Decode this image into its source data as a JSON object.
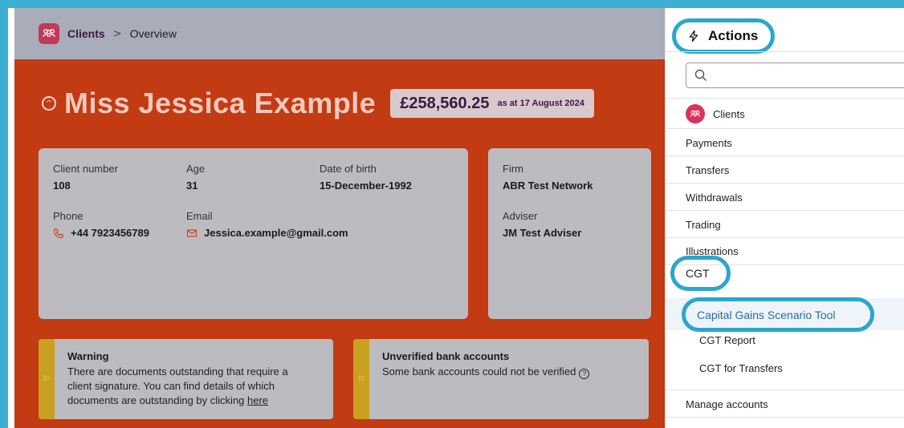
{
  "breadcrumb": {
    "section": "Clients",
    "separator": ">",
    "page": "Overview"
  },
  "client": {
    "name": "Miss Jessica Example",
    "value": "£258,560.25",
    "value_date": "as at 17 August 2024",
    "details": {
      "client_number_label": "Client number",
      "client_number": "108",
      "age_label": "Age",
      "age": "31",
      "dob_label": "Date of birth",
      "dob": "15-December-1992",
      "phone_label": "Phone",
      "phone": "+44 7923456789",
      "email_label": "Email",
      "email": "Jessica.example@gmail.com"
    },
    "firm": {
      "firm_label": "Firm",
      "firm": "ABR Test Network",
      "adviser_label": "Adviser",
      "adviser": "JM Test Adviser"
    }
  },
  "alerts": {
    "warning": {
      "title": "Warning",
      "line1": "There are documents outstanding that require a",
      "line2": "client signature. You can find details of which",
      "line3": "documents are outstanding by clicking ",
      "link": "here"
    },
    "bank": {
      "title": "Unverified bank accounts",
      "body": "Some bank accounts could not be verified",
      "help": "?"
    }
  },
  "actions": {
    "title": "Actions",
    "search_placeholder": "",
    "clients_label": "Clients",
    "items": {
      "payments": "Payments",
      "transfers": "Transfers",
      "withdrawals": "Withdrawals",
      "trading": "Trading",
      "illustrations": "Illustrations",
      "cgt": "CGT",
      "cgt_scenario_tool": "Capital Gains Scenario Tool",
      "cgt_report": "CGT Report",
      "cgt_transfers": "CGT for Transfers",
      "manage_accounts": "Manage accounts"
    }
  },
  "colors": {
    "frame": "#3aafd2",
    "highlight_ring": "#2aa6cf",
    "main_bg": "#c23b13",
    "brand_pink": "#d8325d",
    "warning_stripe": "#c9a020"
  },
  "icons": [
    "clients-icon",
    "collapse-icon",
    "phone-icon",
    "email-icon",
    "flag-icon",
    "help-icon",
    "lightning-icon",
    "search-icon"
  ]
}
